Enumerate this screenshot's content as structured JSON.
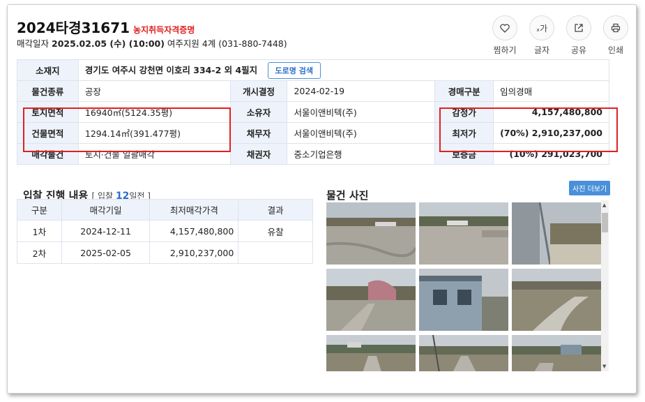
{
  "header": {
    "case_no": "2024타경31671",
    "tag": "농지취득자격증명",
    "date_label": "매각일자",
    "date_value": "2025.02.05 (수) (10:00)",
    "court": "여주지원 4계 (031-880-7448)"
  },
  "actions": [
    {
      "label": "찜하기",
      "icon": "heart-icon"
    },
    {
      "label": "글자",
      "icon": "font-size-icon",
      "glyph": "ₓ가"
    },
    {
      "label": "공유",
      "icon": "share-icon"
    },
    {
      "label": "인쇄",
      "icon": "print-icon"
    }
  ],
  "info": {
    "address_label": "소재지",
    "address": "경기도 여주시 강천면 이호리 334-2 외 4필지",
    "road_btn": "도로명 검색",
    "rows": [
      {
        "h1": "물건종류",
        "v1": "공장",
        "h2": "개시결정",
        "v2": "2024-02-19",
        "h3": "경매구분",
        "v3": "임의경매"
      },
      {
        "h1": "토지면적",
        "v1": "16940㎡(5124.35평)",
        "h2": "소유자",
        "v2": "서울이앤비텍(주)",
        "h3": "감정가",
        "v3": "4,157,480,800"
      },
      {
        "h1": "건물면적",
        "v1": "1294.14㎡(391.477평)",
        "h2": "채무자",
        "v2": "서울이앤비텍(주)",
        "h3": "최저가",
        "v3": "(70%) 2,910,237,000"
      },
      {
        "h1": "매각물건",
        "v1": "토지·건물 일괄매각",
        "h2": "채권자",
        "v2": "중소기업은행",
        "h3": "보증금",
        "v3": "(10%) 291,023,700"
      }
    ]
  },
  "bid": {
    "title": "입찰 진행 내용",
    "sub_prefix": "[ 입찰 ",
    "sub_num": "12",
    "sub_suffix": "일전 ]",
    "columns": [
      "구분",
      "매각기일",
      "최저매각가격",
      "결과"
    ],
    "rows": [
      [
        "1차",
        "2024-12-11",
        "4,157,480,800",
        "유찰"
      ],
      [
        "2차",
        "2025-02-05",
        "2,910,237,000",
        ""
      ]
    ]
  },
  "photos": {
    "title": "물건 사진",
    "more_btn": "사진 더보기"
  },
  "colors": {
    "accent": "#4a90d9",
    "alert": "#e02020",
    "header_bg": "#eef3fb"
  }
}
